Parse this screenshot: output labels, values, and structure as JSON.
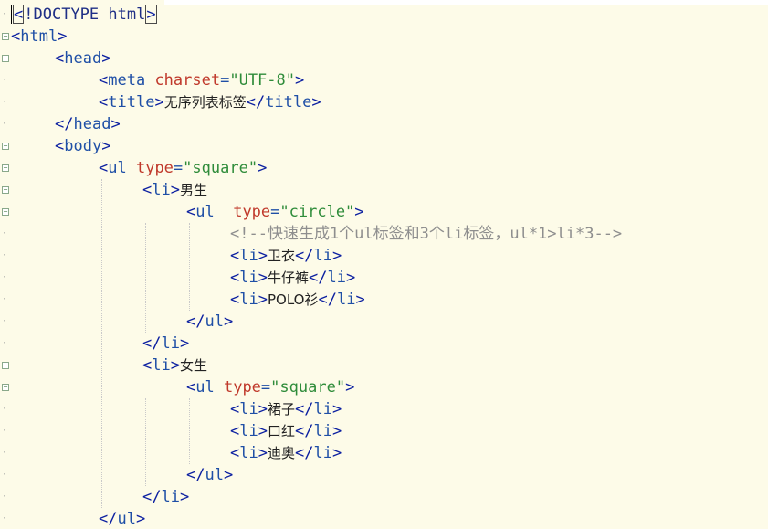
{
  "editor": {
    "lines": [
      [
        {
          "t": "punct",
          "v": "<"
        },
        {
          "t": "doctype",
          "v": "!DOCTYPE html"
        },
        {
          "t": "punct",
          "v": ">"
        }
      ],
      [
        {
          "t": "punct",
          "v": "<"
        },
        {
          "t": "tag",
          "v": "html"
        },
        {
          "t": "punct",
          "v": ">"
        }
      ],
      [
        {
          "t": "punct",
          "v": "<"
        },
        {
          "t": "tag",
          "v": "head"
        },
        {
          "t": "punct",
          "v": ">"
        }
      ],
      [
        {
          "t": "punct",
          "v": "<"
        },
        {
          "t": "tag",
          "v": "meta "
        },
        {
          "t": "attr",
          "v": "charset"
        },
        {
          "t": "eq",
          "v": "="
        },
        {
          "t": "str",
          "v": "\"UTF-8\""
        },
        {
          "t": "punct",
          "v": ">"
        }
      ],
      [
        {
          "t": "punct",
          "v": "<"
        },
        {
          "t": "tag",
          "v": "title"
        },
        {
          "t": "punct",
          "v": ">"
        },
        {
          "t": "text",
          "v": "无序列表标签"
        },
        {
          "t": "punct",
          "v": "</"
        },
        {
          "t": "tag",
          "v": "title"
        },
        {
          "t": "punct",
          "v": ">"
        }
      ],
      [
        {
          "t": "punct",
          "v": "</"
        },
        {
          "t": "tag",
          "v": "head"
        },
        {
          "t": "punct",
          "v": ">"
        }
      ],
      [
        {
          "t": "punct",
          "v": "<"
        },
        {
          "t": "tag",
          "v": "body"
        },
        {
          "t": "punct",
          "v": ">"
        }
      ],
      [
        {
          "t": "punct",
          "v": "<"
        },
        {
          "t": "tag",
          "v": "ul "
        },
        {
          "t": "attr",
          "v": "type"
        },
        {
          "t": "eq",
          "v": "="
        },
        {
          "t": "str",
          "v": "\"square\""
        },
        {
          "t": "punct",
          "v": ">"
        }
      ],
      [
        {
          "t": "punct",
          "v": "<"
        },
        {
          "t": "tag",
          "v": "li"
        },
        {
          "t": "punct",
          "v": ">"
        },
        {
          "t": "text",
          "v": "男生"
        }
      ],
      [
        {
          "t": "punct",
          "v": "<"
        },
        {
          "t": "tag",
          "v": "ul  "
        },
        {
          "t": "attr",
          "v": "type"
        },
        {
          "t": "eq",
          "v": "="
        },
        {
          "t": "str",
          "v": "\"circle\""
        },
        {
          "t": "punct",
          "v": ">"
        }
      ],
      [
        {
          "t": "comment",
          "v": "<!--快速生成1个ul标签和3个li标签，ul*1>li*3-->"
        }
      ],
      [
        {
          "t": "punct",
          "v": "<"
        },
        {
          "t": "tag",
          "v": "li"
        },
        {
          "t": "punct",
          "v": ">"
        },
        {
          "t": "text",
          "v": "卫衣"
        },
        {
          "t": "punct",
          "v": "</"
        },
        {
          "t": "tag",
          "v": "li"
        },
        {
          "t": "punct",
          "v": ">"
        }
      ],
      [
        {
          "t": "punct",
          "v": "<"
        },
        {
          "t": "tag",
          "v": "li"
        },
        {
          "t": "punct",
          "v": ">"
        },
        {
          "t": "text",
          "v": "牛仔裤"
        },
        {
          "t": "punct",
          "v": "</"
        },
        {
          "t": "tag",
          "v": "li"
        },
        {
          "t": "punct",
          "v": ">"
        }
      ],
      [
        {
          "t": "punct",
          "v": "<"
        },
        {
          "t": "tag",
          "v": "li"
        },
        {
          "t": "punct",
          "v": ">"
        },
        {
          "t": "text",
          "v": "POLO衫"
        },
        {
          "t": "punct",
          "v": "</"
        },
        {
          "t": "tag",
          "v": "li"
        },
        {
          "t": "punct",
          "v": ">"
        }
      ],
      [
        {
          "t": "punct",
          "v": "</"
        },
        {
          "t": "tag",
          "v": "ul"
        },
        {
          "t": "punct",
          "v": ">"
        }
      ],
      [
        {
          "t": "punct",
          "v": "</"
        },
        {
          "t": "tag",
          "v": "li"
        },
        {
          "t": "punct",
          "v": ">"
        }
      ],
      [
        {
          "t": "punct",
          "v": "<"
        },
        {
          "t": "tag",
          "v": "li"
        },
        {
          "t": "punct",
          "v": ">"
        },
        {
          "t": "text",
          "v": "女生"
        }
      ],
      [
        {
          "t": "punct",
          "v": "<"
        },
        {
          "t": "tag",
          "v": "ul "
        },
        {
          "t": "attr",
          "v": "type"
        },
        {
          "t": "eq",
          "v": "="
        },
        {
          "t": "str",
          "v": "\"square\""
        },
        {
          "t": "punct",
          "v": ">"
        }
      ],
      [
        {
          "t": "punct",
          "v": "<"
        },
        {
          "t": "tag",
          "v": "li"
        },
        {
          "t": "punct",
          "v": ">"
        },
        {
          "t": "text",
          "v": "裙子"
        },
        {
          "t": "punct",
          "v": "</"
        },
        {
          "t": "tag",
          "v": "li"
        },
        {
          "t": "punct",
          "v": ">"
        }
      ],
      [
        {
          "t": "punct",
          "v": "<"
        },
        {
          "t": "tag",
          "v": "li"
        },
        {
          "t": "punct",
          "v": ">"
        },
        {
          "t": "text",
          "v": "口红"
        },
        {
          "t": "punct",
          "v": "</"
        },
        {
          "t": "tag",
          "v": "li"
        },
        {
          "t": "punct",
          "v": ">"
        }
      ],
      [
        {
          "t": "punct",
          "v": "<"
        },
        {
          "t": "tag",
          "v": "li"
        },
        {
          "t": "punct",
          "v": ">"
        },
        {
          "t": "text",
          "v": "迪奥"
        },
        {
          "t": "punct",
          "v": "</"
        },
        {
          "t": "tag",
          "v": "li"
        },
        {
          "t": "punct",
          "v": ">"
        }
      ],
      [
        {
          "t": "punct",
          "v": "</"
        },
        {
          "t": "tag",
          "v": "ul"
        },
        {
          "t": "punct",
          "v": ">"
        }
      ],
      [
        {
          "t": "punct",
          "v": "</"
        },
        {
          "t": "tag",
          "v": "li"
        },
        {
          "t": "punct",
          "v": ">"
        }
      ],
      [
        {
          "t": "punct",
          "v": "</"
        },
        {
          "t": "tag",
          "v": "ul"
        },
        {
          "t": "punct",
          "v": ">"
        }
      ]
    ]
  },
  "colors": {
    "background": "#fdfbe8",
    "tag": "#1f4fa6",
    "attribute": "#c0392b",
    "string": "#2f8c3a",
    "comment": "#8e8e8e",
    "punctuation": "#0b1fa0"
  }
}
